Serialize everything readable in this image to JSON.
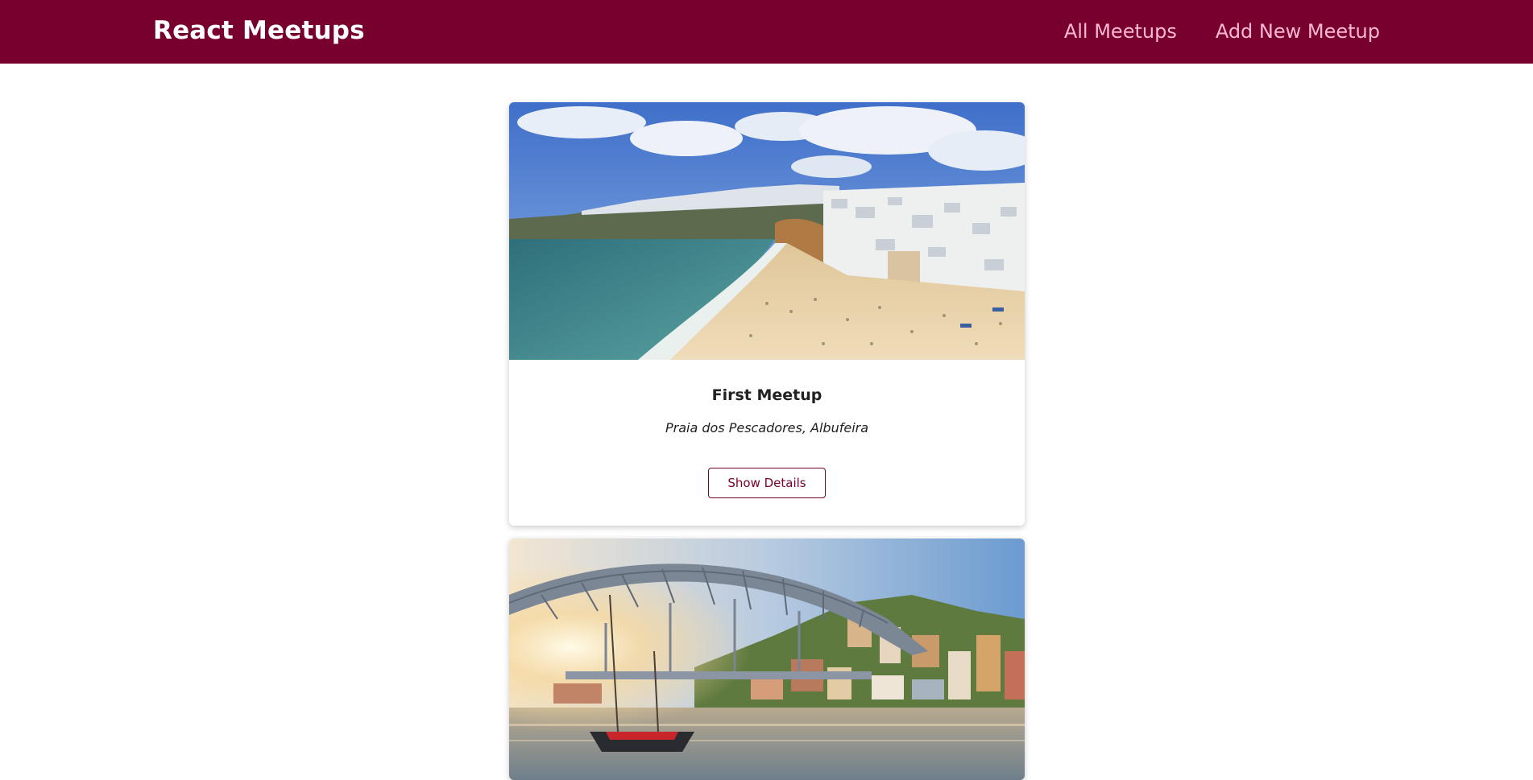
{
  "header": {
    "logo": "React Meetups",
    "nav": {
      "all_meetups": "All Meetups",
      "add_new_meetup": "Add New Meetup"
    }
  },
  "meetups": [
    {
      "title": "First Meetup",
      "address": "Praia dos Pescadores, Albufeira",
      "button_label": "Show Details",
      "image_subject": "beach-town-photo"
    },
    {
      "image_subject": "river-bridge-city-photo"
    }
  ],
  "colors": {
    "header_bg": "#77002e",
    "nav_text": "#fcb8d2",
    "accent": "#77002e"
  }
}
